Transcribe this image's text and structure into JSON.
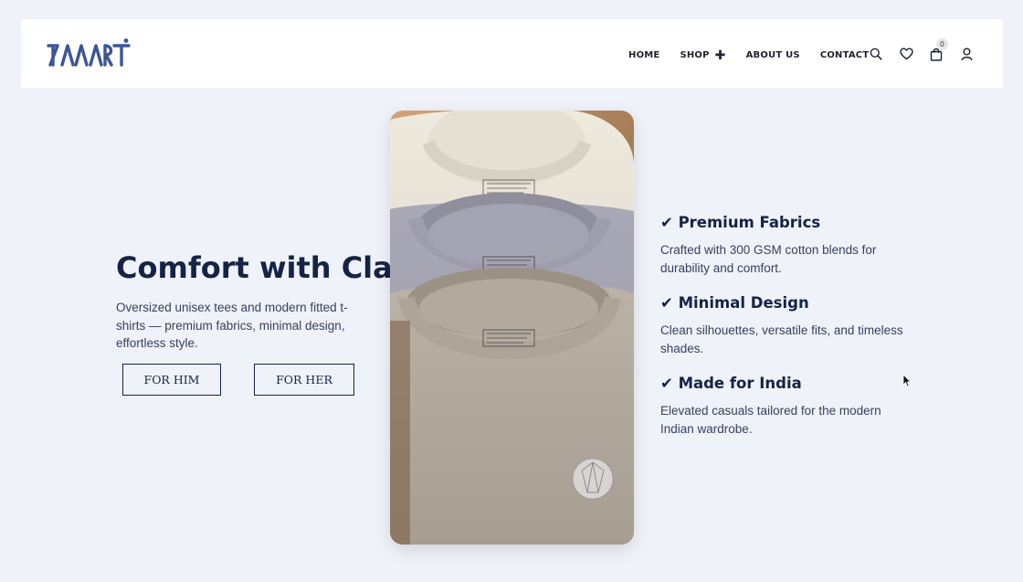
{
  "header": {
    "logo_text": "AZAARI",
    "nav": [
      {
        "label": "HOME"
      },
      {
        "label": "SHOP"
      },
      {
        "label": "ABOUT US"
      },
      {
        "label": "CONTACT"
      }
    ],
    "icons": [
      "search-icon",
      "heart-icon",
      "bag-icon",
      "user-icon"
    ],
    "cart_count": "0"
  },
  "hero": {
    "title": "Comfort with Class",
    "description": "Oversized unisex tees and modern fitted t-shirts — premium fabrics, minimal design, effortless style.",
    "buttons": {
      "him": "FOR HIM",
      "her": "FOR HER"
    }
  },
  "features": [
    {
      "title": "✔ Premium Fabrics",
      "description": "Crafted with 300 GSM cotton blends for durability and comfort."
    },
    {
      "title": "✔ Minimal Design",
      "description": "Clean silhouettes, versatile fits, and timeless shades."
    },
    {
      "title": "✔ Made for India",
      "description": "Elevated casuals tailored for the modern Indian wardrobe."
    }
  ],
  "colors": {
    "background": "#eff2f8",
    "heading": "#152346",
    "text": "#384060",
    "logo": "#3d5596"
  }
}
